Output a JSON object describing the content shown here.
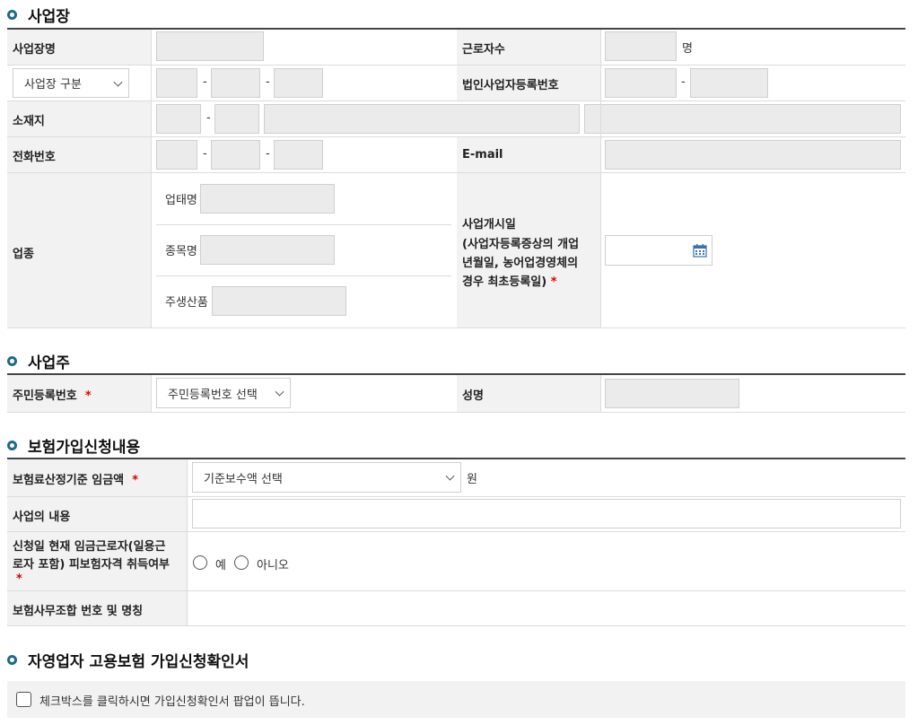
{
  "workplace": {
    "title": "사업장",
    "name_label": "사업장명",
    "workers_label": "근로자수",
    "workers_unit": "명",
    "category_select": "사업장 구분",
    "corp_reg_label": "법인사업자등록번호",
    "address_label": "소재지",
    "phone_label": "전화번호",
    "email_label": "E-mail",
    "industry_label": "업종",
    "biz_type_label": "업태명",
    "item_label": "종목명",
    "main_product_label": "주생산품",
    "start_date_label_1": "사업개시일",
    "start_date_label_2": "(사업자등록증상의 개업",
    "start_date_label_3": "년월일, 농어업경영체의",
    "start_date_label_4": "경우 최초등록일)",
    "required_mark": "*",
    "dash": "-"
  },
  "owner": {
    "title": "사업주",
    "rrn_label": "주민등록번호",
    "rrn_select": "주민등록번호 선택",
    "name_label": "성명"
  },
  "insurance": {
    "title": "보험가입신청내용",
    "wage_label": "보험료산정기준 임금액",
    "wage_select": "기준보수액 선택",
    "wage_unit": "원",
    "business_content_label": "사업의 내용",
    "insured_status_label_1": "신청일 현재 임금근로자(일용근",
    "insured_status_label_2": "로자 포함) 피보험자격 취득여부",
    "radio_yes": "예",
    "radio_no": "아니오",
    "agency_label": "보험사무조합 번호 및 명칭"
  },
  "confirmation": {
    "title": "자영업자 고용보험 가입신청확인서",
    "checkbox_label": "체크박스를 클릭하시면 가입신청확인서 팝업이 뜹니다."
  },
  "colors": {
    "accent": "#1d6a8a",
    "required": "#dd0000",
    "label_bg": "#f2f2f2",
    "input_bg": "#ebebeb"
  }
}
